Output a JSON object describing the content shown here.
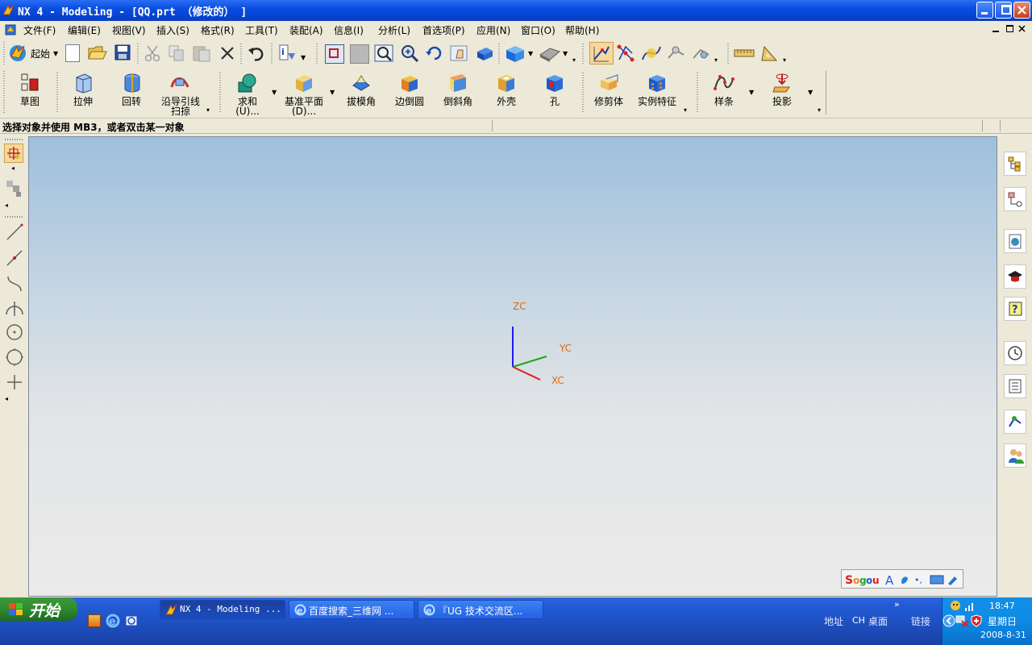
{
  "window": {
    "title": "NX 4 - Modeling - [QQ.prt （修改的） ]"
  },
  "menu": [
    "文件(F)",
    "编辑(E)",
    "视图(V)",
    "插入(S)",
    "格式(R)",
    "工具(T)",
    "装配(A)",
    "信息(I)",
    "分析(L)",
    "首选项(P)",
    "应用(N)",
    "窗口(O)",
    "帮助(H)"
  ],
  "toolbar1": {
    "start_label": "起始"
  },
  "toolbar2": {
    "sketch": "草图",
    "extrude": "拉伸",
    "revolve": "回转",
    "sweep_line1": "沿导引线",
    "sweep_line2": "扫掠",
    "unite_line1": "求和",
    "unite_line2": "(U)...",
    "datum_line1": "基准平面",
    "datum_line2": "(D)...",
    "draft": "拔模角",
    "edge_blend": "边倒圆",
    "chamfer": "倒斜角",
    "shell": "外壳",
    "hole": "孔",
    "trim_body": "修剪体",
    "instance": "实例特征",
    "spline": "样条",
    "project": "投影"
  },
  "status": {
    "prompt": "选择对象并使用 MB3，或者双击某一对象"
  },
  "axes": {
    "zc": "ZC",
    "yc": "YC",
    "xc": "XC",
    "z_color": "#1a1aff",
    "y_color": "#1aa81a",
    "x_color": "#e01a1a",
    "label_color": "#e06a10"
  },
  "taskbar": {
    "start": "开始",
    "tasks": [
      "NX 4 - Modeling ...",
      "百度搜索_三维网 ...",
      "『UG 技术交流区..."
    ],
    "address": "地址",
    "lang": "CH",
    "desktop": "桌面",
    "links": "链接",
    "chevron": "»",
    "time": "18:47",
    "weekday": "星期日",
    "date": "2008-8-31"
  },
  "colors": {
    "title_blue": "#0a4ee0",
    "taskbar_blue": "#245edb",
    "start_green": "#2e8b2e"
  }
}
